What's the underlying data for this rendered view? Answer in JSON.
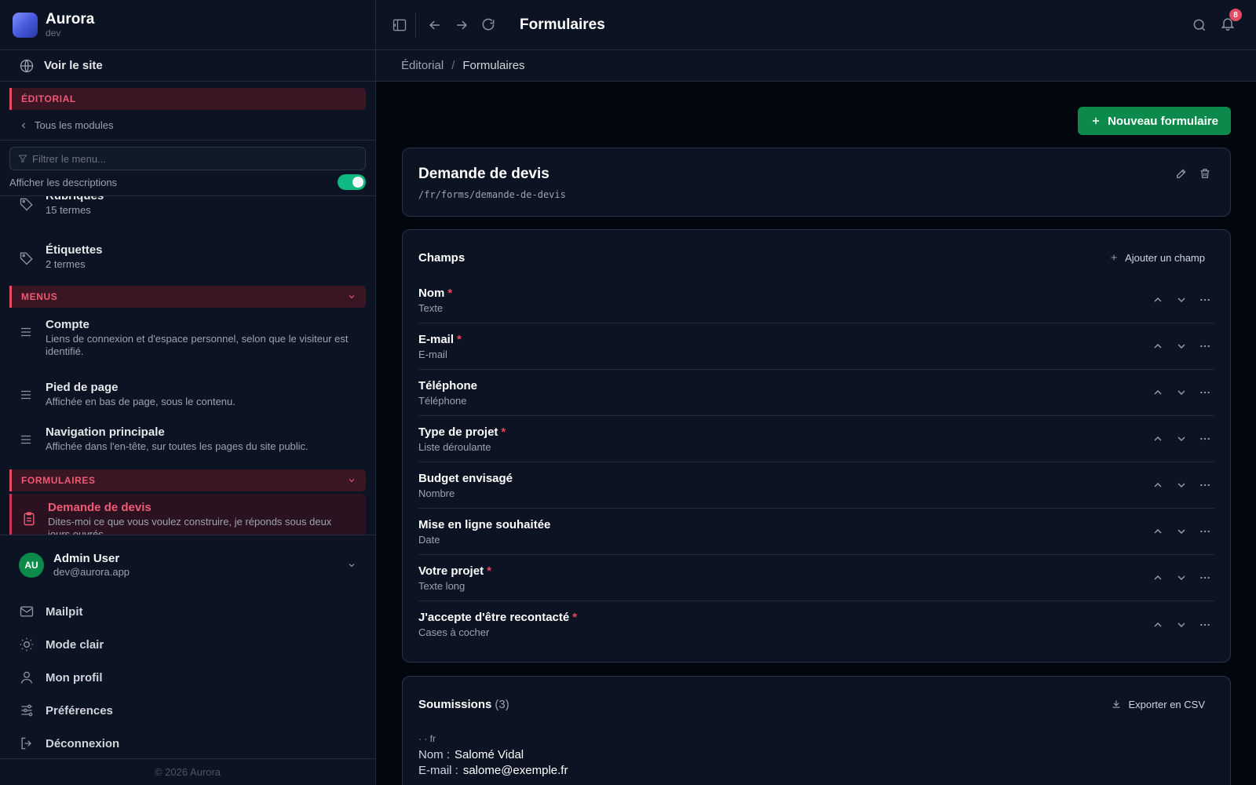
{
  "app": {
    "name": "Aurora",
    "env": "dev"
  },
  "sidebar": {
    "view_site": "Voir le site",
    "module_header": "ÉDITORIAL",
    "back_label": "Tous les modules",
    "filter_placeholder": "Filtrer le menu...",
    "show_desc_label": "Afficher les descriptions",
    "show_desc_on": true,
    "taxonomy_items": [
      {
        "title": "Rubriques",
        "desc": "15 termes",
        "icon": "tag-icon"
      },
      {
        "title": "Étiquettes",
        "desc": "2 termes",
        "icon": "tag-icon"
      }
    ],
    "menus_header": "MENUS",
    "menu_items": [
      {
        "title": "Compte",
        "desc": "Liens de connexion et d'espace personnel, selon que le visiteur est identifié.",
        "icon": "menu-icon"
      },
      {
        "title": "Pied de page",
        "desc": "Affichée en bas de page, sous le contenu.",
        "icon": "menu-icon"
      },
      {
        "title": "Navigation principale",
        "desc": "Affichée dans l'en-tête, sur toutes les pages du site public.",
        "icon": "menu-icon"
      }
    ],
    "forms_header": "FORMULAIRES",
    "form_items": [
      {
        "title": "Demande de devis",
        "desc": "Dites-moi ce que vous voulez construire, je réponds sous deux jours ouvrés.",
        "icon": "clipboard-icon",
        "active": true
      }
    ]
  },
  "user": {
    "initials": "AU",
    "name": "Admin User",
    "email": "dev@aurora.app",
    "menu": [
      {
        "label": "Mailpit",
        "icon": "mail-icon"
      },
      {
        "label": "Mode clair",
        "icon": "sun-icon"
      },
      {
        "label": "Mon profil",
        "icon": "user-icon"
      },
      {
        "label": "Préférences",
        "icon": "sliders-icon"
      },
      {
        "label": "Déconnexion",
        "icon": "logout-icon"
      }
    ]
  },
  "footer": {
    "copyright": "© 2026 Aurora"
  },
  "topbar": {
    "title": "Formulaires",
    "notifications": "8"
  },
  "breadcrumb": {
    "parent": "Éditorial",
    "separator": "/",
    "current": "Formulaires"
  },
  "main": {
    "new_button": "Nouveau formulaire",
    "form": {
      "title": "Demande de devis",
      "path": "/fr/forms/demande-de-devis"
    },
    "fields_title": "Champs",
    "add_field": "Ajouter un champ",
    "fields": [
      {
        "label": "Nom",
        "type": "Texte",
        "required": true
      },
      {
        "label": "E-mail",
        "type": "E-mail",
        "required": true
      },
      {
        "label": "Téléphone",
        "type": "Téléphone",
        "required": false
      },
      {
        "label": "Type de projet",
        "type": "Liste déroulante",
        "required": true
      },
      {
        "label": "Budget envisagé",
        "type": "Nombre",
        "required": false
      },
      {
        "label": "Mise en ligne souhaitée",
        "type": "Date",
        "required": false
      },
      {
        "label": "Votre projet",
        "type": "Texte long",
        "required": true
      },
      {
        "label": "J'accepte d'être recontacté",
        "type": "Cases à cocher",
        "required": true
      }
    ],
    "submissions_title": "Soumissions",
    "submissions_count": "(3)",
    "export": "Exporter en CSV",
    "submission": {
      "lang": "· · fr",
      "lines": [
        {
          "key": "Nom :",
          "value": "Salomé Vidal"
        },
        {
          "key": "E-mail :",
          "value": "salome@exemple.fr"
        }
      ]
    }
  }
}
